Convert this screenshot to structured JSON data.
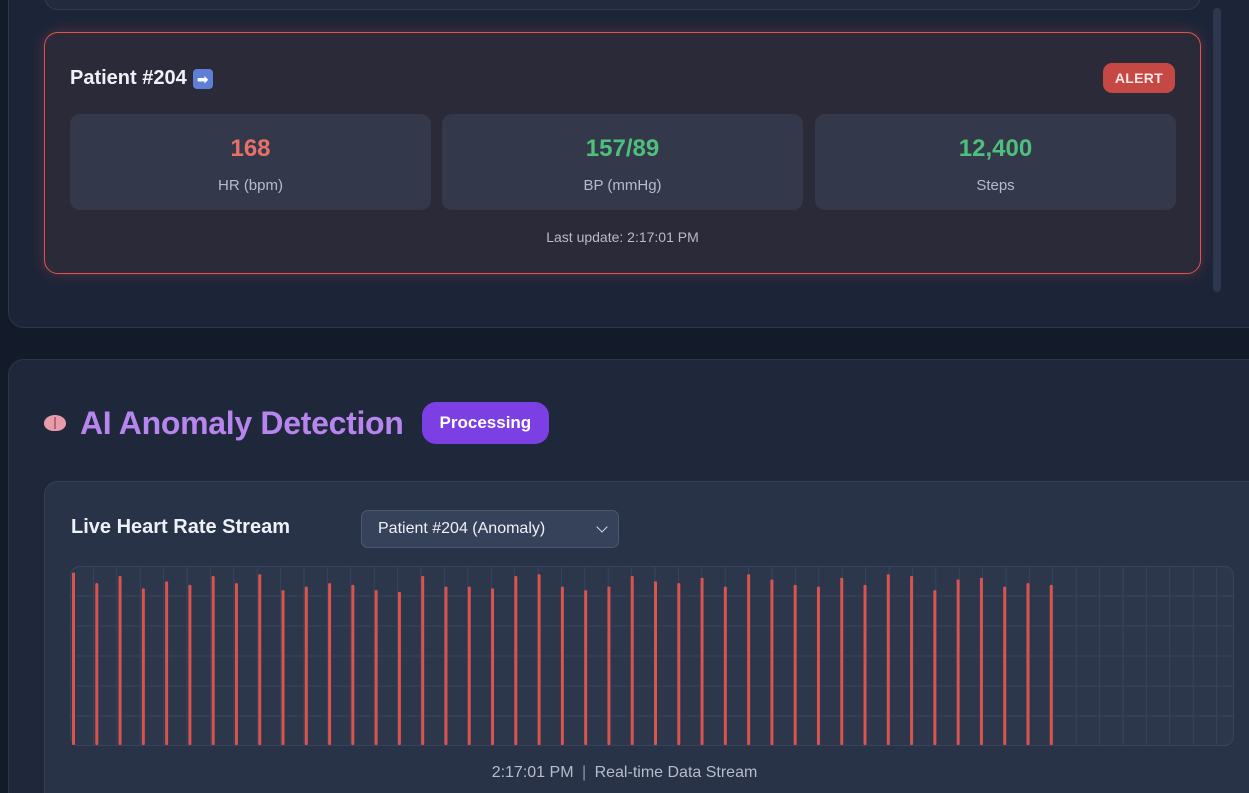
{
  "patient_card": {
    "title": "Patient #204",
    "arrow_icon": "➡",
    "badge": "ALERT",
    "metrics": [
      {
        "value": "168",
        "label": "HR (bpm)",
        "color": "#e8706b"
      },
      {
        "value": "157/89",
        "label": "BP (mmHg)",
        "color": "#4fbf7c"
      },
      {
        "value": "12,400",
        "label": "Steps",
        "color": "#4fbf7c"
      }
    ],
    "last_update": "Last update: 2:17:01 PM"
  },
  "anomaly_section": {
    "title": "AI Anomaly Detection",
    "status_badge": "Processing"
  },
  "chart_panel": {
    "heading": "Live Heart Rate Stream",
    "selected_patient": "Patient #204 (Anomaly)",
    "caption_time": "2:17:01 PM",
    "caption_separator": "|",
    "caption_label": "Real-time Data Stream"
  },
  "colors": {
    "alert_red": "#e0534f",
    "accent_purple": "#7b3fe4",
    "bar_color": "#d9534f"
  },
  "chart_data": {
    "type": "bar",
    "x_range": [
      0,
      50
    ],
    "y_range": [
      0,
      1
    ],
    "grid": true,
    "values": [
      0.98,
      0.92,
      0.96,
      0.89,
      0.93,
      0.91,
      0.96,
      0.92,
      0.97,
      0.88,
      0.9,
      0.92,
      0.91,
      0.88,
      0.87,
      0.96,
      0.9,
      0.9,
      0.89,
      0.96,
      0.97,
      0.9,
      0.88,
      0.9,
      0.96,
      0.93,
      0.92,
      0.95,
      0.9,
      0.97,
      0.94,
      0.91,
      0.9,
      0.95,
      0.91,
      0.97,
      0.96,
      0.88,
      0.94,
      0.95,
      0.9,
      0.92,
      0.91
    ]
  }
}
